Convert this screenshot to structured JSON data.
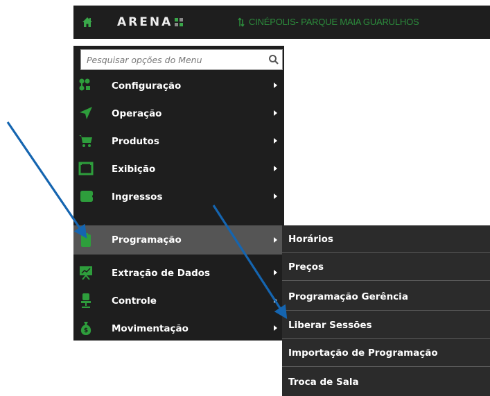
{
  "header": {
    "logo_text": "ARENA",
    "location": "CINÉPOLIS- PARQUE MAIA GUARULHOS"
  },
  "search": {
    "placeholder": "Pesquisar opções do Menu",
    "value": ""
  },
  "menu": {
    "items": [
      {
        "label": "Configuração",
        "icon": "sitemap-icon"
      },
      {
        "label": "Operação",
        "icon": "send-icon"
      },
      {
        "label": "Produtos",
        "icon": "cart-icon"
      },
      {
        "label": "Exibição",
        "icon": "screen-icon"
      },
      {
        "label": "Ingressos",
        "icon": "tickets-icon"
      },
      {
        "label": "Programação",
        "icon": "clipboard-icon",
        "active": true
      },
      {
        "label": "Extração de Dados",
        "icon": "presentation-icon"
      },
      {
        "label": "Controle",
        "icon": "chair-icon"
      },
      {
        "label": "Movimentação",
        "icon": "money-bag-icon"
      }
    ]
  },
  "submenu": {
    "items": [
      {
        "label": "Horários"
      },
      {
        "label": "Preços"
      },
      {
        "label": "Programação Gerência"
      },
      {
        "label": "Liberar Sessões"
      },
      {
        "label": "Importação de Programação"
      },
      {
        "label": "Troca de Sala"
      }
    ]
  },
  "colors": {
    "topbar": "#1e1e1e",
    "sidebar": "#1e1e1e",
    "active_item": "#555555",
    "submenu": "#2b2b2b",
    "icon_green": "#2e9e3c",
    "annotation_arrow": "#1565b0"
  }
}
